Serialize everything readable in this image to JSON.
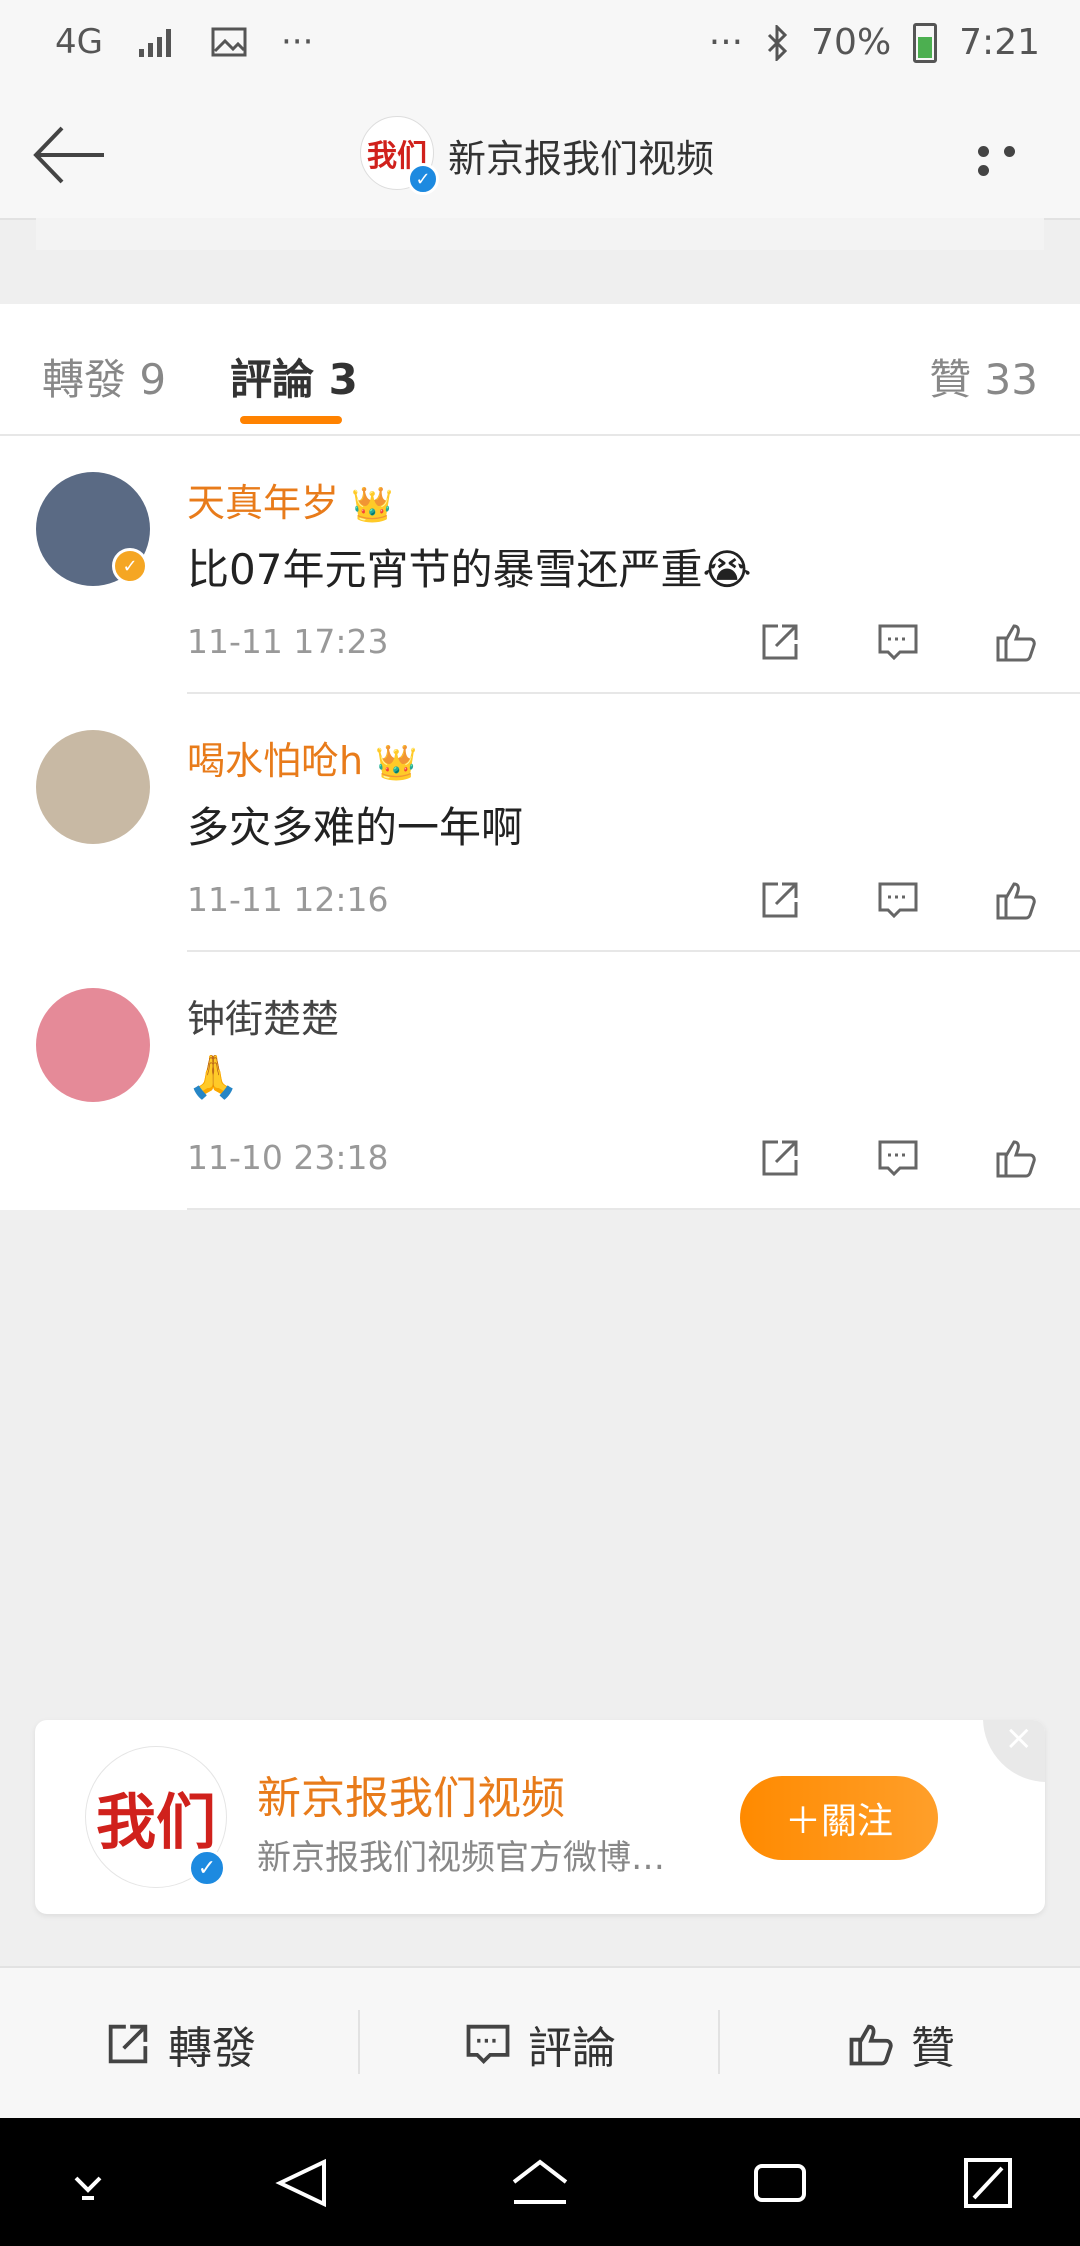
{
  "status_bar": {
    "network": "4G",
    "dots_left": "···",
    "dots_right": "···",
    "battery": "70%",
    "time": "7:21"
  },
  "header": {
    "avatar_text": "我们",
    "title": "新京报我们视频"
  },
  "tabs": [
    {
      "label": "轉發 9",
      "active": false
    },
    {
      "label": "評論 3",
      "active": true
    },
    {
      "label": "贊 33",
      "active": false
    }
  ],
  "comments": [
    {
      "user": "天真年岁",
      "vip_badge": "👑",
      "text": "比07年元宵节的暴雪还严重😭",
      "time": "11-11 17:23",
      "avatar_color": "#5a6a84"
    },
    {
      "user": "喝水怕呛h",
      "vip_badge": "👑",
      "text": "多灾多难的一年啊",
      "time": "11-11 12:16",
      "avatar_color": "#c8b9a4"
    },
    {
      "user": "钟街楚楚",
      "vip_badge": "",
      "text": "🙏",
      "time": "11-10 23:18",
      "avatar_color": "#e58a98"
    }
  ],
  "follow_card": {
    "avatar_text": "我们",
    "name": "新京报我们视频",
    "desc": "新京报我们视频官方微博…",
    "follow_label": "＋關注",
    "close_label": "×"
  },
  "action_bar": {
    "repost": "轉發",
    "comment": "評論",
    "like": "贊"
  },
  "colors": {
    "accent": "#ff8200",
    "username": "#e87b1a",
    "verified": "#1d8ae0"
  }
}
